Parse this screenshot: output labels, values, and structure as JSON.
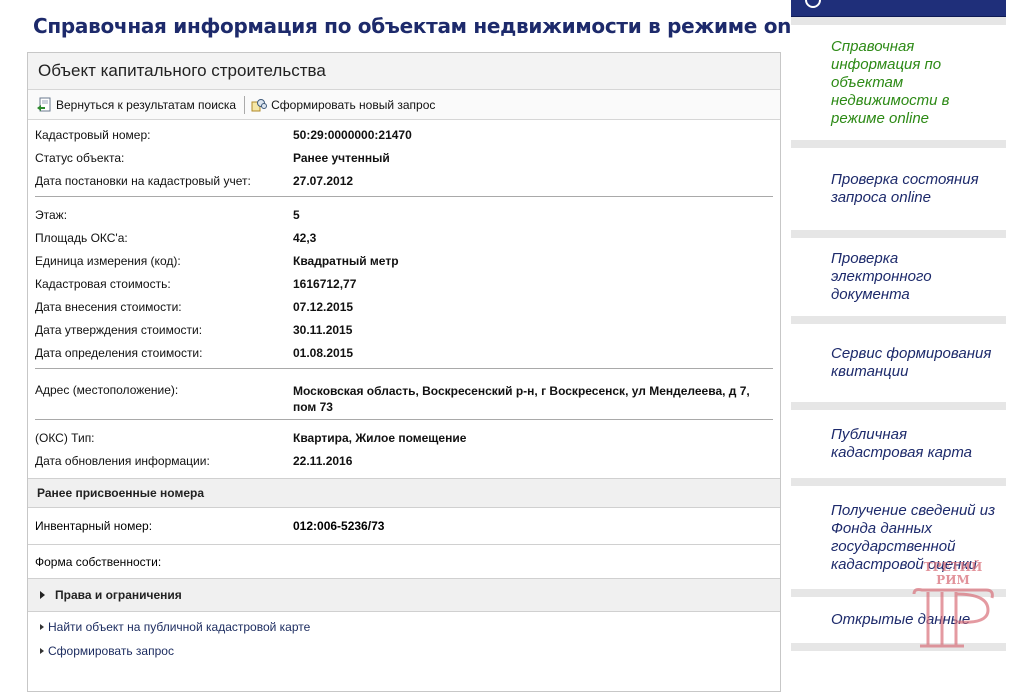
{
  "page_title": "Справочная информация по объектам недвижимости в режиме online",
  "panel": {
    "title": "Объект капитального строительства",
    "toolbar": {
      "back_label": "Вернуться к результатам поиска",
      "new_query_label": "Сформировать новый запрос"
    },
    "fields_group1": [
      {
        "key": "Кадастровый номер:",
        "value": "50:29:0000000:21470"
      },
      {
        "key": "Статус объекта:",
        "value": "Ранее учтенный"
      },
      {
        "key": "Дата постановки на кадастровый учет:",
        "value": "27.07.2012"
      }
    ],
    "fields_group2": [
      {
        "key": "Этаж:",
        "value": "5"
      },
      {
        "key": "Площадь ОКС'а:",
        "value": "42,3"
      },
      {
        "key": "Единица измерения (код):",
        "value": "Квадратный метр"
      },
      {
        "key": "Кадастровая стоимость:",
        "value": "1616712,77"
      },
      {
        "key": "Дата внесения стоимости:",
        "value": "07.12.2015"
      },
      {
        "key": "Дата утверждения стоимости:",
        "value": "30.11.2015"
      },
      {
        "key": "Дата определения стоимости:",
        "value": "01.08.2015"
      }
    ],
    "address": {
      "key": "Адрес (местоположение):",
      "value": "Московская область, Воскресенский р-н, г Воскресенск, ул Менделеева, д 7, пом 73"
    },
    "fields_group3": [
      {
        "key": "(ОКС) Тип:",
        "value": "Квартира, Жилое помещение"
      },
      {
        "key": "Дата обновления информации:",
        "value": "22.11.2016"
      }
    ],
    "prev_numbers_heading": "Ранее присвоенные номера",
    "inventory": {
      "key": "Инвентарный номер:",
      "value": "012:006-5236/73"
    },
    "ownership_label": "Форма собственности:",
    "rights_label": "Права и ограничения",
    "links": [
      "Найти объект на публичной кадастровой карте",
      "Сформировать запрос"
    ]
  },
  "sidebar": {
    "items": [
      {
        "label": "Справочная информация по объектам недвижимости в режиме online"
      },
      {
        "label": "Проверка состояния запроса online"
      },
      {
        "label": "Проверка электронного документа"
      },
      {
        "label": "Сервис формирования квитанции"
      },
      {
        "label": "Публичная кадастровая карта"
      },
      {
        "label": "Получение сведений из Фонда данных государственной кадастровой оценки"
      },
      {
        "label": "Открытые данные"
      }
    ]
  },
  "watermark": {
    "text": "ТРЕТИЙ РИМ"
  },
  "colors": {
    "title": "#1d2a6b",
    "sidebar_active": "#2d8a16",
    "sidebar_link": "#1d2a6b",
    "sidebar_top": "#1f2f7a",
    "watermark": "#d9707a"
  }
}
